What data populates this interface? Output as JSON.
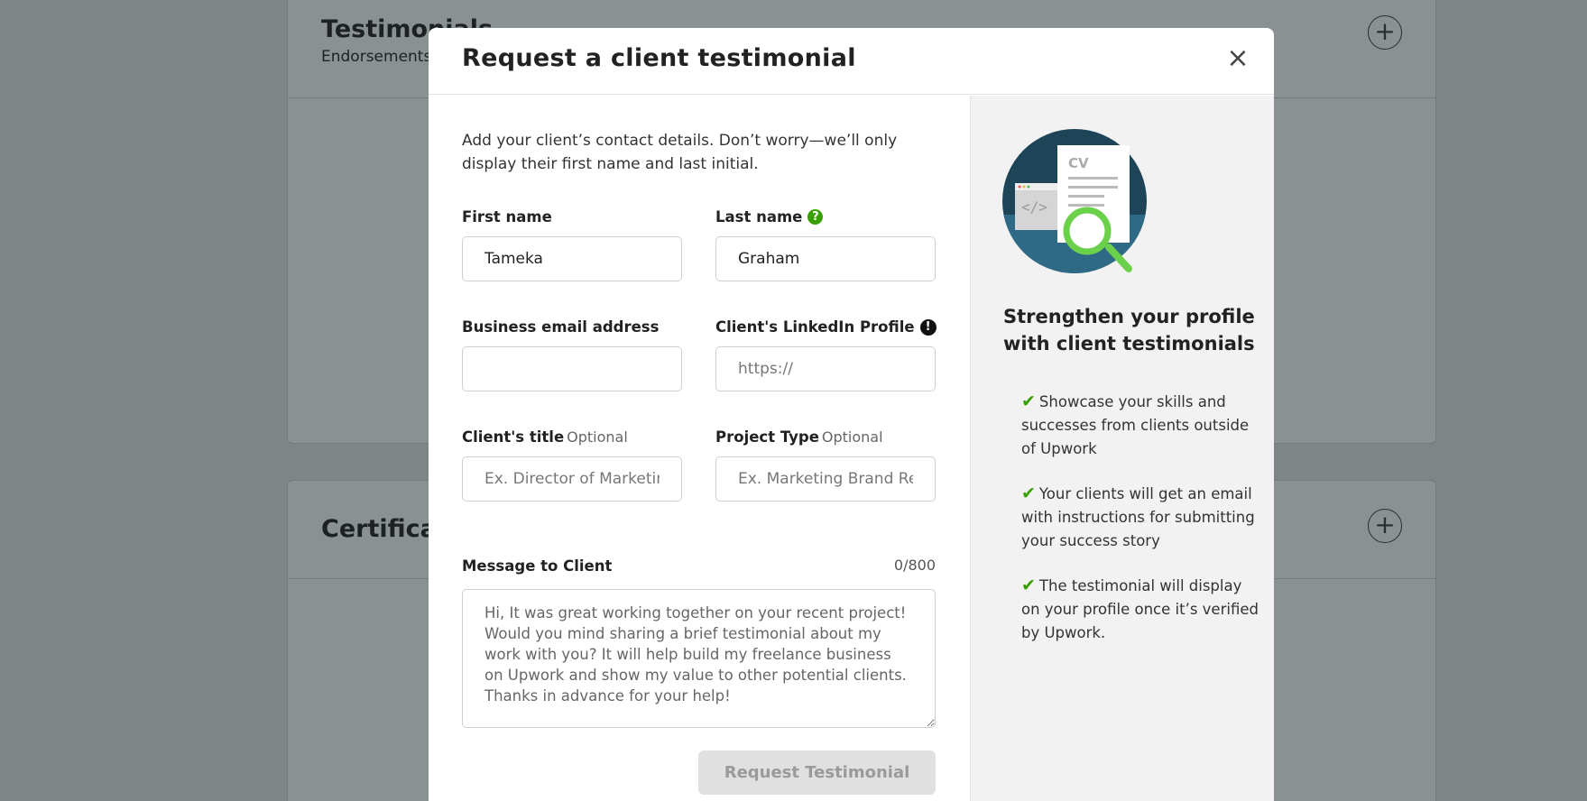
{
  "background": {
    "section1_title": "Testimonials",
    "section1_subtitle": "Endorsements",
    "section2_title": "Certifications",
    "plus": "+"
  },
  "modal": {
    "title": "Request a client testimonial",
    "close": "×",
    "intro": "Add your client’s contact details. Don’t worry—we’ll only display their first name and last initial.",
    "fields": {
      "first_name": {
        "label": "First name",
        "value": "Tameka"
      },
      "last_name": {
        "label": "Last name",
        "value": "Graham",
        "help": "?"
      },
      "email": {
        "label": "Business email address",
        "value": ""
      },
      "linkedin": {
        "label": "Client's LinkedIn Profile",
        "placeholder": "https://",
        "warn": "!"
      },
      "client_title": {
        "label": "Client's title",
        "optional": "Optional",
        "placeholder": "Ex. Director of Marketing"
      },
      "project_type": {
        "label": "Project Type",
        "optional": "Optional",
        "placeholder": "Ex. Marketing Brand Refresh"
      },
      "message": {
        "label": "Message to Client",
        "counter": "0/800",
        "placeholder": "Hi, It was great working together on your recent project! Would you mind sharing a brief testimonial about my work with you? It will help build my freelance business on Upwork and show my value to other potential clients. Thanks in advance for your help!"
      }
    },
    "submit_label": "Request Testimonial",
    "sidebar": {
      "heading": "Strengthen your profile with client testimonials",
      "illustration_text": "CV",
      "check_glyph": "✔",
      "benefits": [
        "Showcase your skills and successes from clients outside of Upwork",
        "Your clients will get an email with instructions for submitting your success story",
        "The testimonial will display on your profile once it’s verified by Upwork."
      ]
    }
  },
  "colors": {
    "accent_green": "#37a000",
    "overlay": "#7d8587",
    "button_disabled_bg": "#e0e0e0"
  }
}
